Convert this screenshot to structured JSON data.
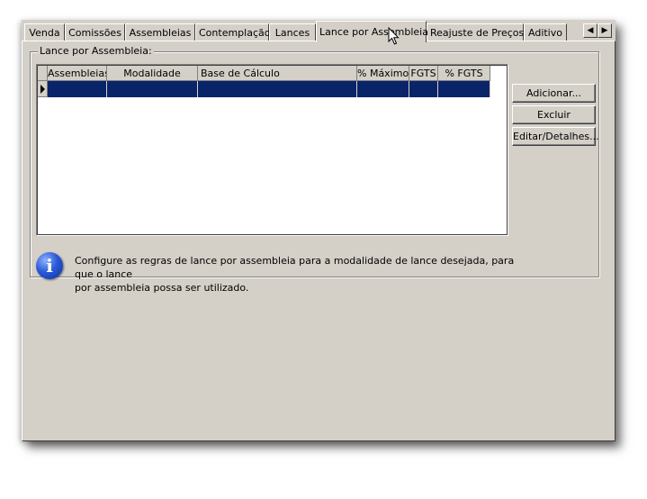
{
  "tabs": [
    {
      "label": "Venda",
      "active": false
    },
    {
      "label": "Comissões",
      "active": false
    },
    {
      "label": "Assembleias",
      "active": false
    },
    {
      "label": "Contemplação",
      "active": false
    },
    {
      "label": "Lances",
      "active": false
    },
    {
      "label": "Lance por Assembleia",
      "active": true
    },
    {
      "label": "Reajuste de Preços",
      "active": false
    },
    {
      "label": "Aditivo",
      "active": false
    }
  ],
  "tab_scroll": {
    "left": "◀",
    "right": "▶"
  },
  "group": {
    "title": "Lance por Assembleia:"
  },
  "grid": {
    "columns": [
      "Assembleias",
      "Modalidade",
      "Base de Cálculo",
      "% Máximo",
      "FGTS",
      "% FGTS"
    ],
    "rows": [
      [
        "",
        "",
        "",
        "",
        "",
        ""
      ]
    ]
  },
  "buttons": {
    "add": "Adicionar...",
    "delete": "Excluir",
    "edit": "Editar/Detalhes..."
  },
  "info": {
    "icon": "info-icon",
    "line1": "Configure as regras de lance por assembleia para a modalidade de lance desejada, para que o lance",
    "line2": "por assembleia possa ser utilizado."
  },
  "colors": {
    "selection": "#0a246a",
    "face": "#d4d0c8"
  }
}
